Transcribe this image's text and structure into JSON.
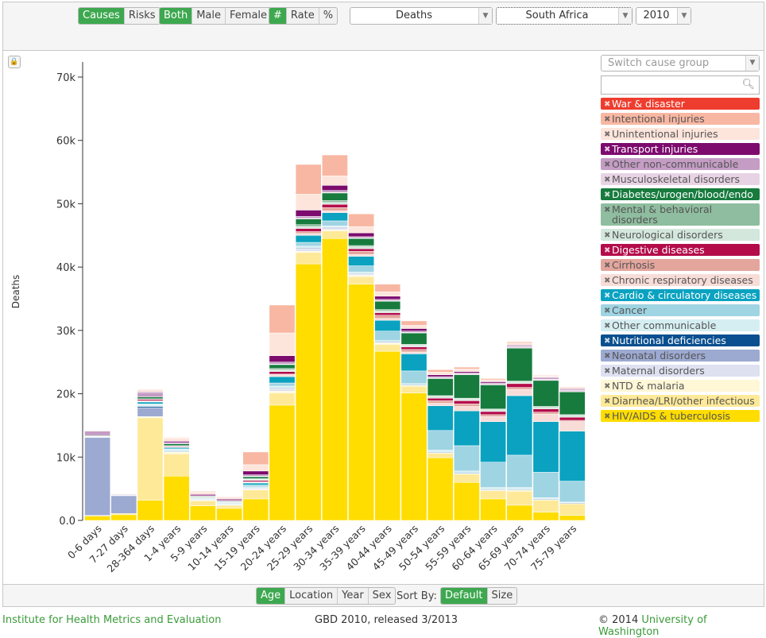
{
  "toolbar": {
    "measure_group": [
      {
        "label": "Causes",
        "active": true
      },
      {
        "label": "Risks",
        "active": false
      }
    ],
    "sex_group": [
      {
        "label": "Both",
        "active": true
      },
      {
        "label": "Male",
        "active": false
      },
      {
        "label": "Female",
        "active": false
      }
    ],
    "unit_group": [
      {
        "label": "#",
        "active": true
      },
      {
        "label": "Rate",
        "active": false
      },
      {
        "label": "%",
        "active": false
      }
    ],
    "metric": "Deaths",
    "location": "South Africa",
    "year": "2010"
  },
  "sidebar": {
    "cause_group_placeholder": "Switch cause group",
    "search_value": ""
  },
  "bottom": {
    "view_group": [
      {
        "label": "Age",
        "active": true
      },
      {
        "label": "Location",
        "active": false
      },
      {
        "label": "Year",
        "active": false
      },
      {
        "label": "Sex",
        "active": false
      }
    ],
    "sort_label": "Sort By:",
    "sort_group": [
      {
        "label": "Default",
        "active": true
      },
      {
        "label": "Size",
        "active": false
      }
    ]
  },
  "footer": {
    "left": "Institute for Health Metrics and Evaluation",
    "center": "GBD 2010, released 3/2013",
    "right_prefix": "© 2014 ",
    "right_link": "University of Washington"
  },
  "chart_data": {
    "type": "bar",
    "stacked": true,
    "ylabel": "Deaths",
    "ylim": [
      0,
      72000
    ],
    "yticks": [
      0,
      10000,
      20000,
      30000,
      40000,
      50000,
      60000,
      70000
    ],
    "ytick_labels": [
      "0.0",
      "10k",
      "20k",
      "30k",
      "40k",
      "50k",
      "60k",
      "70k"
    ],
    "grid": false,
    "legend": "right",
    "categories": [
      "0-6 days",
      "7-27 days",
      "28-364 days",
      "1-4 years",
      "5-9 years",
      "10-14 years",
      "15-19 years",
      "20-24 years",
      "25-29 years",
      "30-34 years",
      "35-39 years",
      "40-44 years",
      "45-49 years",
      "50-54 years",
      "55-59 years",
      "60-64 years",
      "65-69 years",
      "70-74 years",
      "75-79 years"
    ],
    "series": [
      {
        "name": "HIV/AIDS & tuberculosis",
        "color": "#ffdd00",
        "values": [
          700,
          900,
          3200,
          7000,
          2300,
          1900,
          3400,
          18200,
          40500,
          44500,
          37300,
          26700,
          20100,
          9900,
          6000,
          3400,
          2400,
          1300,
          800
        ]
      },
      {
        "name": "Diarrhea/LRI/other infectious",
        "color": "#fee998",
        "values": [
          100,
          200,
          13000,
          3500,
          800,
          500,
          1400,
          1900,
          1800,
          1200,
          1200,
          1100,
          1100,
          700,
          1300,
          1300,
          2200,
          1900,
          1800
        ]
      },
      {
        "name": "NTD & malaria",
        "color": "#fff7d6",
        "values": [
          0,
          0,
          200,
          300,
          100,
          50,
          100,
          300,
          200,
          200,
          200,
          200,
          100,
          100,
          100,
          100,
          200,
          100,
          100
        ]
      },
      {
        "name": "Maternal disorders",
        "color": "#dde1f0",
        "values": [
          0,
          0,
          0,
          0,
          0,
          0,
          200,
          400,
          400,
          300,
          200,
          100,
          0,
          0,
          0,
          0,
          0,
          0,
          0
        ]
      },
      {
        "name": "Neonatal disorders",
        "color": "#9ca9d1",
        "values": [
          12300,
          2800,
          1400,
          0,
          0,
          0,
          0,
          0,
          0,
          0,
          0,
          0,
          0,
          0,
          0,
          0,
          0,
          0,
          0
        ]
      },
      {
        "name": "Nutritional deficiencies",
        "color": "#0a4f8f",
        "values": [
          0,
          0,
          200,
          100,
          0,
          0,
          0,
          100,
          100,
          100,
          100,
          100,
          100,
          100,
          100,
          100,
          100,
          100,
          100
        ]
      },
      {
        "name": "Other communicable",
        "color": "#d5eef2",
        "values": [
          100,
          100,
          300,
          300,
          100,
          100,
          200,
          300,
          300,
          200,
          200,
          200,
          200,
          300,
          300,
          300,
          300,
          200,
          100
        ]
      },
      {
        "name": "Cancer",
        "color": "#9fd4e3",
        "values": [
          0,
          0,
          100,
          100,
          100,
          100,
          300,
          500,
          600,
          800,
          1000,
          1500,
          2000,
          3100,
          4000,
          4000,
          5100,
          4000,
          3300
        ]
      },
      {
        "name": "Cardio & circulatory diseases",
        "color": "#0aa2c0",
        "values": [
          0,
          0,
          300,
          200,
          100,
          100,
          300,
          1000,
          1100,
          1300,
          1500,
          1700,
          2700,
          3900,
          5500,
          6400,
          9400,
          8000,
          7900
        ]
      },
      {
        "name": "Chronic respiratory diseases",
        "color": "#f7dcd8",
        "values": [
          100,
          0,
          200,
          100,
          100,
          100,
          200,
          300,
          300,
          300,
          300,
          300,
          300,
          400,
          700,
          800,
          1000,
          1200,
          1500
        ]
      },
      {
        "name": "Cirrhosis",
        "color": "#e3a59c",
        "values": [
          0,
          0,
          0,
          0,
          0,
          0,
          0,
          100,
          300,
          500,
          500,
          500,
          400,
          400,
          400,
          300,
          300,
          300,
          200
        ]
      },
      {
        "name": "Digestive diseases",
        "color": "#b40c4a",
        "values": [
          0,
          0,
          200,
          100,
          0,
          0,
          200,
          400,
          500,
          500,
          400,
          400,
          400,
          400,
          500,
          500,
          600,
          500,
          500
        ]
      },
      {
        "name": "Neurological disorders",
        "color": "#d3e7dc",
        "values": [
          0,
          0,
          100,
          100,
          100,
          100,
          200,
          300,
          300,
          300,
          300,
          300,
          300,
          300,
          300,
          300,
          300,
          400,
          400
        ]
      },
      {
        "name": "Mental & behavioral disorders",
        "color": "#8fbd9f",
        "values": [
          0,
          0,
          0,
          0,
          0,
          0,
          100,
          200,
          300,
          300,
          200,
          200,
          100,
          100,
          100,
          100,
          100,
          0,
          0
        ]
      },
      {
        "name": "Diabetes/urogen/blood/endo",
        "color": "#177b3e",
        "values": [
          100,
          0,
          300,
          300,
          100,
          100,
          300,
          600,
          900,
          1200,
          1100,
          1300,
          1800,
          2700,
          3700,
          3800,
          5200,
          4100,
          3600
        ]
      },
      {
        "name": "Musculoskeletal disorders",
        "color": "#e8d3e5",
        "values": [
          0,
          0,
          0,
          0,
          0,
          0,
          100,
          100,
          100,
          100,
          100,
          100,
          100,
          100,
          100,
          100,
          200,
          200,
          200
        ]
      },
      {
        "name": "Other non-communicable",
        "color": "#c49cc4",
        "values": [
          700,
          100,
          700,
          200,
          100,
          100,
          200,
          300,
          300,
          300,
          200,
          200,
          200,
          200,
          200,
          200,
          200,
          200,
          200
        ]
      },
      {
        "name": "Transport injuries",
        "color": "#7d0b6e",
        "values": [
          0,
          0,
          100,
          200,
          200,
          200,
          600,
          1000,
          1000,
          800,
          600,
          500,
          400,
          300,
          200,
          200,
          100,
          100,
          100
        ]
      },
      {
        "name": "Unintentional injuries",
        "color": "#fde5dc",
        "values": [
          100,
          100,
          300,
          500,
          400,
          300,
          1000,
          3600,
          2500,
          1500,
          1000,
          700,
          500,
          400,
          400,
          300,
          300,
          200,
          200
        ]
      },
      {
        "name": "Intentional injuries",
        "color": "#f8b7a2",
        "values": [
          0,
          0,
          100,
          100,
          100,
          100,
          2000,
          4400,
          4700,
          3300,
          2000,
          1200,
          700,
          400,
          300,
          200,
          200,
          100,
          100
        ]
      },
      {
        "name": "War & disaster",
        "color": "#ee3d2e",
        "values": [
          0,
          0,
          0,
          0,
          0,
          0,
          0,
          0,
          0,
          0,
          0,
          0,
          0,
          0,
          0,
          0,
          0,
          0,
          0
        ]
      }
    ]
  }
}
